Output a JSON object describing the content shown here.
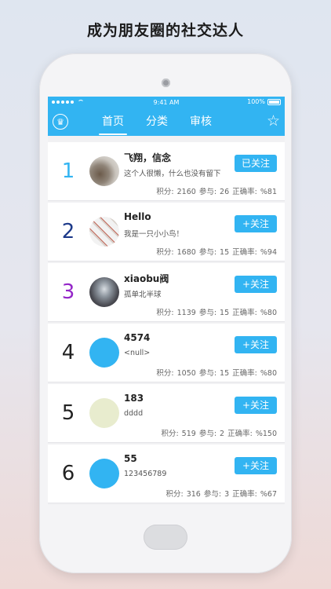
{
  "headline": "成为朋友圈的社交达人",
  "status_bar": {
    "time": "9:41 AM",
    "battery": "100%"
  },
  "nav": {
    "left_icon": "trophy-icon",
    "right_icon": "star-icon",
    "tabs": [
      {
        "label": "首页",
        "active": true
      },
      {
        "label": "分类",
        "active": false
      },
      {
        "label": "审核",
        "active": false
      }
    ]
  },
  "colors": {
    "accent": "#32b4f2",
    "rank1": "#32b4f2",
    "rank2": "#1d3a8a",
    "rank3": "#9426c8",
    "rank_default": "#222222"
  },
  "users": [
    {
      "rank": "1",
      "name": "飞翔，信念",
      "bio": "这个人很懒，什么也没有留下",
      "follow": "已关注",
      "stats": "积分: 2160 参与: 26 正确率: %81"
    },
    {
      "rank": "2",
      "name": "Hello",
      "bio": "我是一只小小鸟！",
      "follow": "+关注",
      "stats": "积分: 1680 参与: 15 正确率: %94"
    },
    {
      "rank": "3",
      "name": "xiaobu阀",
      "bio": "孤单北半球",
      "follow": "+关注",
      "stats": "积分: 1139 参与: 15 正确率: %80"
    },
    {
      "rank": "4",
      "name": "4574",
      "bio": "<null>",
      "follow": "+关注",
      "stats": "积分: 1050 参与: 15 正确率: %80"
    },
    {
      "rank": "5",
      "name": "183",
      "bio": "dddd",
      "follow": "+关注",
      "stats": "积分: 519 参与: 2 正确率: %150"
    },
    {
      "rank": "6",
      "name": "55",
      "bio": " 123456789",
      "follow": "+关注",
      "stats": "积分: 316 参与: 3 正确率: %67"
    }
  ]
}
